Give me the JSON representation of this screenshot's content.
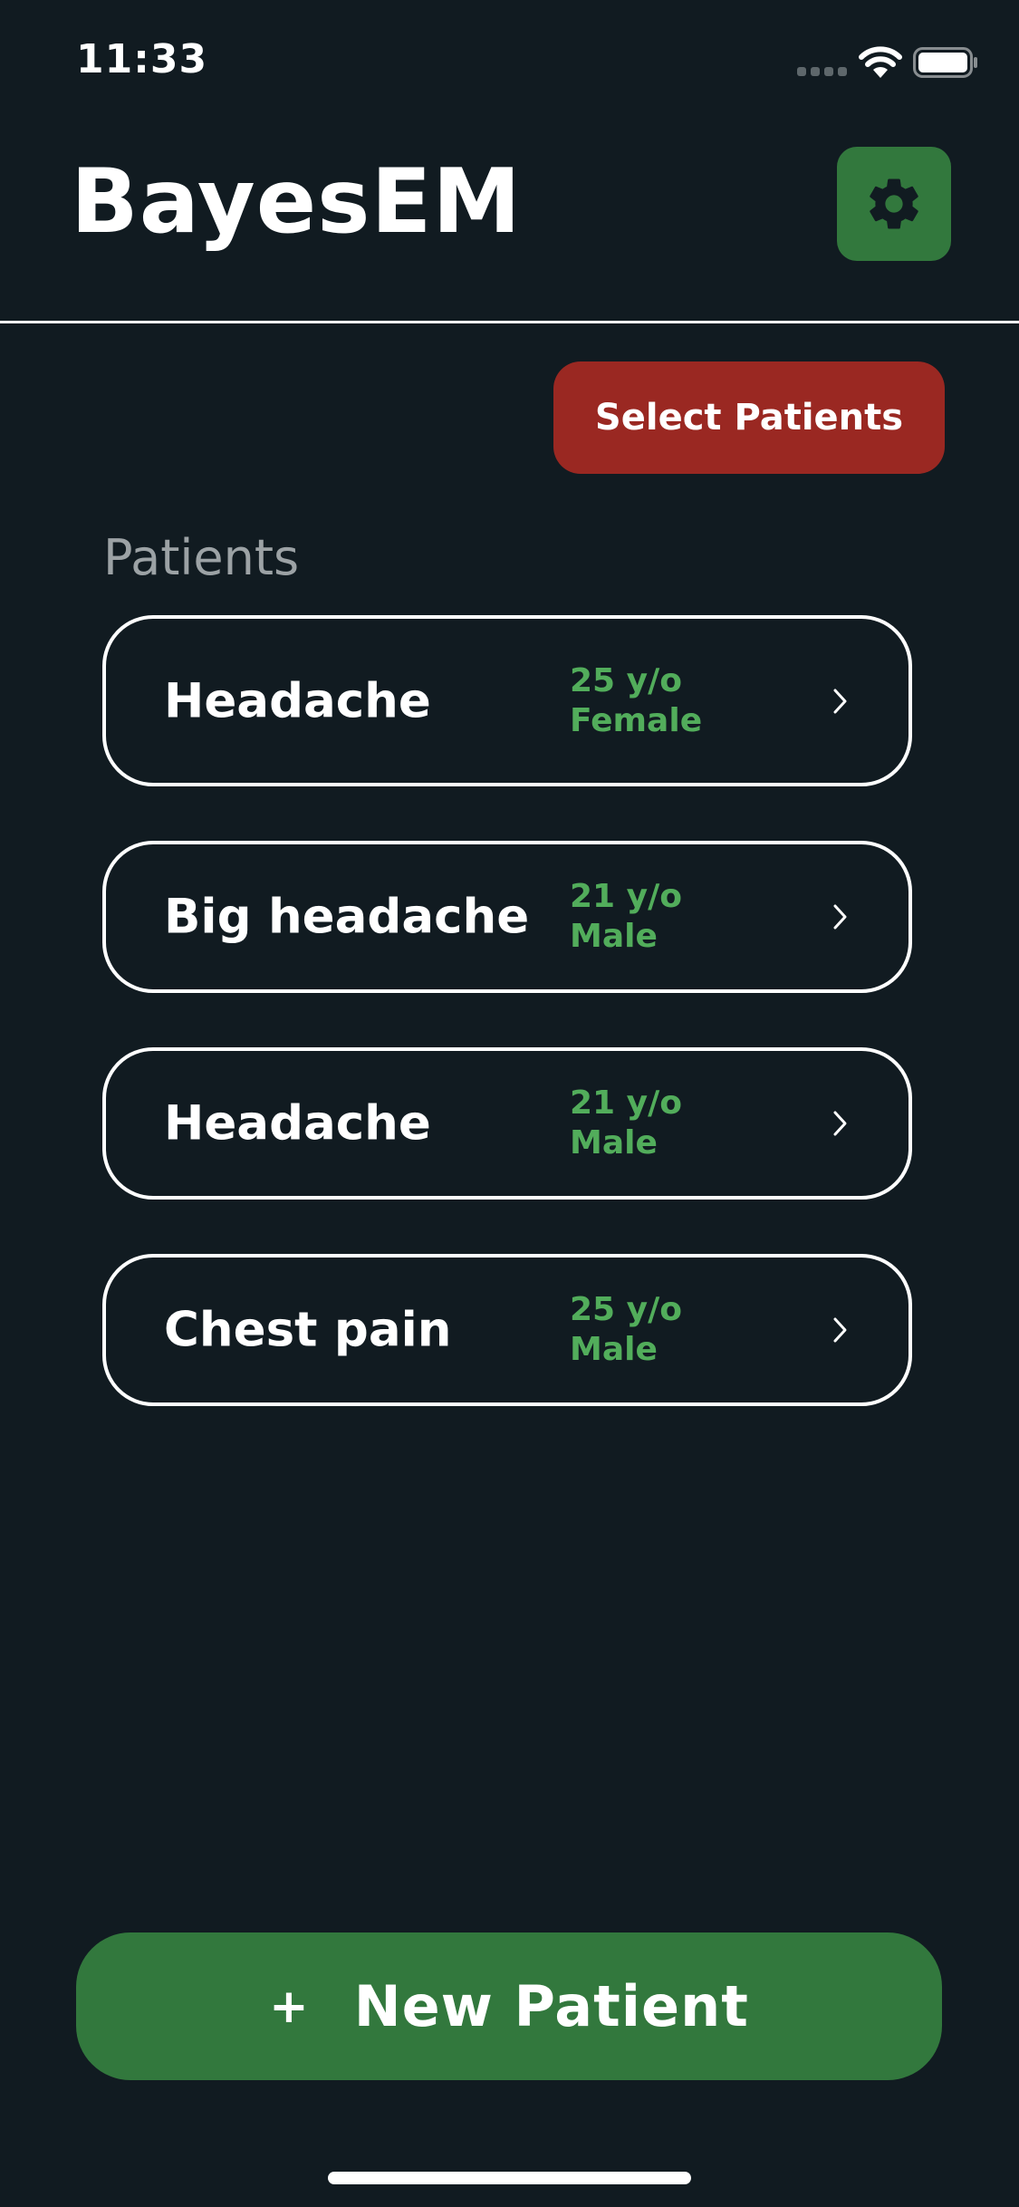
{
  "status_bar": {
    "time": "11:33"
  },
  "header": {
    "logo_text": "BayesEM",
    "settings_icon": "gear-icon",
    "settings_color": "#32783d"
  },
  "actions": {
    "select_patients_label": "Select Patients",
    "select_patients_color": "#9a2822"
  },
  "patients": {
    "section_label": "Patients",
    "items": [
      {
        "title": "Headache",
        "meta": "25 y/o Female"
      },
      {
        "title": "Big headache",
        "meta": "21 y/o Male"
      },
      {
        "title": "Headache",
        "meta": "21 y/o Male"
      },
      {
        "title": "Chest pain",
        "meta": "25 y/o Male"
      }
    ]
  },
  "footer": {
    "new_patient_icon": "+",
    "new_patient_label": "New Patient",
    "new_patient_color": "#32783d"
  },
  "colors": {
    "background": "#111b21",
    "accent_green_text": "#52ad5b"
  }
}
